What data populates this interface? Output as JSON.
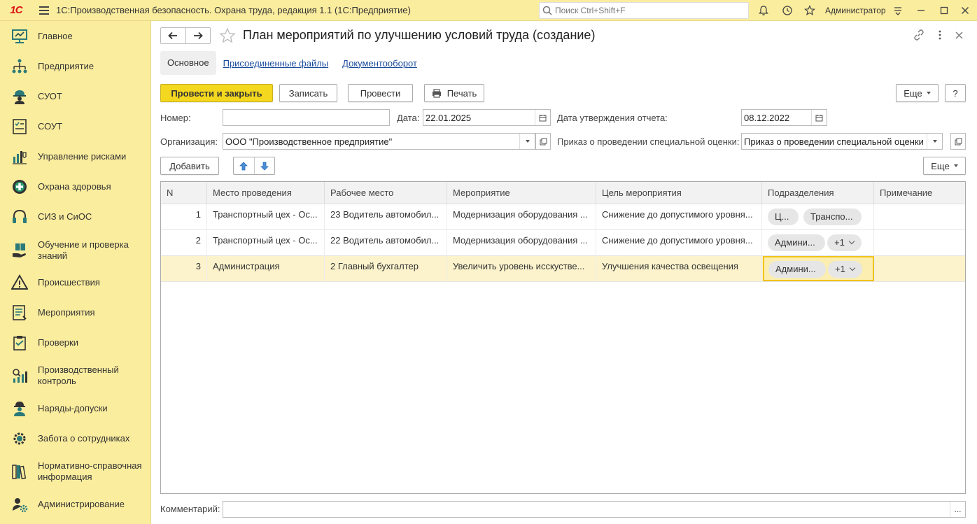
{
  "app": {
    "logo": "1С",
    "title": "1С:Производственная безопасность. Охрана труда, редакция 1.1  (1С:Предприятие)",
    "search_placeholder": "Поиск Ctrl+Shift+F",
    "user": "Администратор"
  },
  "sidebar": {
    "items": [
      {
        "label": "Главное",
        "icon": "monitor-icon"
      },
      {
        "label": "Предприятие",
        "icon": "org-structure-icon"
      },
      {
        "label": "СУОТ",
        "icon": "hardhat-worker-icon"
      },
      {
        "label": "СОУТ",
        "icon": "checklist-icon"
      },
      {
        "label": "Управление рисками",
        "icon": "risk-chart-icon"
      },
      {
        "label": "Охрана здоровья",
        "icon": "medical-cross-icon"
      },
      {
        "label": "СИЗ и СиОС",
        "icon": "headphones-icon"
      },
      {
        "label": "Обучение и проверка знаний",
        "icon": "hand-book-icon"
      },
      {
        "label": "Происшествия",
        "icon": "warning-icon"
      },
      {
        "label": "Мероприятия",
        "icon": "list-document-icon"
      },
      {
        "label": "Проверки",
        "icon": "clipboard-check-icon"
      },
      {
        "label": "Производственный контроль",
        "icon": "control-chart-icon"
      },
      {
        "label": "Наряды-допуски",
        "icon": "worker-permit-icon"
      },
      {
        "label": "Забота о сотрудниках",
        "icon": "care-gear-icon"
      },
      {
        "label": "Нормативно-справочная информация",
        "icon": "books-icon"
      },
      {
        "label": "Администрирование",
        "icon": "admin-gear-icon"
      }
    ]
  },
  "document": {
    "title": "План мероприятий по улучшению условий труда (создание)",
    "tabs": {
      "main": "Основное",
      "files": "Присоединенные файлы",
      "docflow": "Документооборот"
    },
    "toolbar": {
      "post_close": "Провести и закрыть",
      "save": "Записать",
      "post": "Провести",
      "print": "Печать",
      "more": "Еще",
      "help": "?"
    },
    "fields": {
      "number_label": "Номер:",
      "number_value": "",
      "date_label": "Дата:",
      "date_value": "22.01.2025",
      "approval_date_label": "Дата утверждения отчета:",
      "approval_date_value": "08.12.2022",
      "org_label": "Организация:",
      "org_value": "ООО \"Производственное предприятие\"",
      "order_label": "Приказ о проведении специальной оценки:",
      "order_value": "Приказ о проведении специальной оценки ПП"
    },
    "table_toolbar": {
      "add": "Добавить",
      "more": "Еще"
    },
    "table": {
      "columns": [
        "N",
        "Место проведения",
        "Рабочее место",
        "Мероприятие",
        "Цель мероприятия",
        "Подразделения",
        "Примечание"
      ],
      "rows": [
        {
          "n": "1",
          "place": "Транспортный цех - Ос...",
          "workplace": "23 Водитель автомобил...",
          "measure": "Модернизация оборудования ...",
          "goal": "Снижение до допустимого уровня...",
          "divisions": [
            "Ц...",
            "Транспо..."
          ],
          "note": ""
        },
        {
          "n": "2",
          "place": "Транспортный цех - Ос...",
          "workplace": "22 Водитель автомобил...",
          "measure": "Модернизация оборудования ...",
          "goal": "Снижение до допустимого уровня...",
          "divisions": [
            "Админи...",
            "+1"
          ],
          "note": ""
        },
        {
          "n": "3",
          "place": "Администрация",
          "workplace": "2 Главный бухгалтер",
          "measure": "Увеличить уровень исскуstве...",
          "goal": "Улучшения качества освещения",
          "divisions": [
            "Админи...",
            "+1"
          ],
          "note": ""
        }
      ]
    },
    "comment": {
      "label": "Комментарий:",
      "value": "",
      "dots": "..."
    }
  },
  "colors": {
    "accent": "#fbed9e",
    "primary_button": "#f4d820",
    "selected_row": "#fcf3cc",
    "link": "#1a4c9c"
  }
}
